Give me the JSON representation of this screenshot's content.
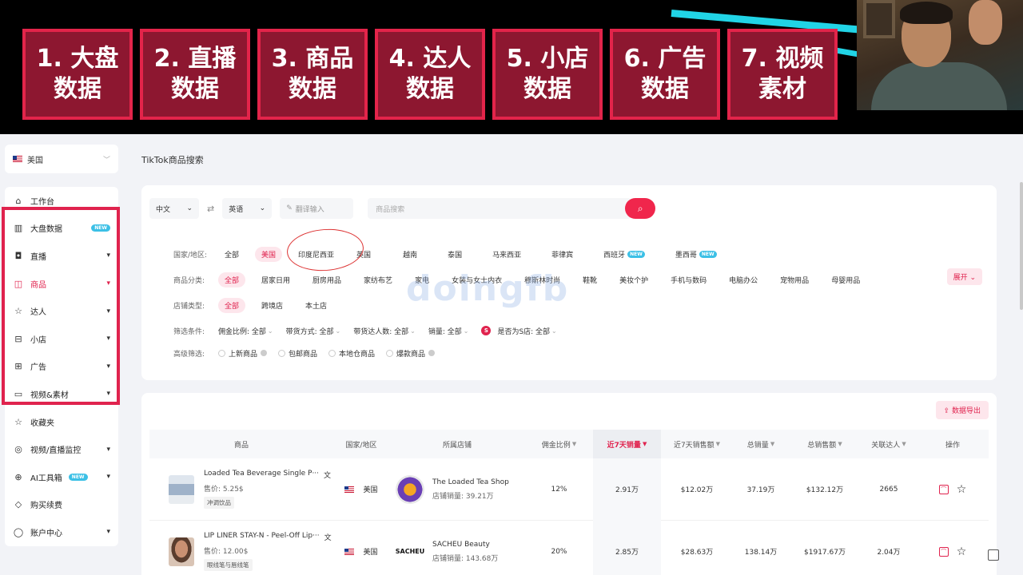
{
  "banner": {
    "tiles": [
      {
        "line1": "1. 大盘",
        "line2": "数据"
      },
      {
        "line1": "2. 直播",
        "line2": "数据"
      },
      {
        "line1": "3. 商品",
        "line2": "数据"
      },
      {
        "line1": "4. 达人",
        "line2": "数据"
      },
      {
        "line1": "5. 小店",
        "line2": "数据"
      },
      {
        "line1": "6. 广告",
        "line2": "数据"
      },
      {
        "line1": "7. 视频",
        "line2": "素材"
      }
    ],
    "tile_color": "#8d1730",
    "tile_border": "#e3244a"
  },
  "sidebar": {
    "region": "美国",
    "items": [
      {
        "label": "工作台",
        "icon": "home-icon"
      },
      {
        "label": "大盘数据",
        "icon": "bar-chart-icon",
        "badge": "NEW"
      },
      {
        "label": "直播",
        "icon": "live-icon",
        "arrow": "▾"
      },
      {
        "label": "商品",
        "icon": "bag-icon",
        "arrow": "▾"
      },
      {
        "label": "达人",
        "icon": "star-person-icon",
        "arrow": "▾"
      },
      {
        "label": "小店",
        "icon": "store-icon",
        "arrow": "▾"
      },
      {
        "label": "广告",
        "icon": "ad-icon",
        "arrow": "▾"
      },
      {
        "label": "视频&素材",
        "icon": "video-icon",
        "arrow": "▾"
      },
      {
        "label": "收藏夹",
        "icon": "star-icon"
      },
      {
        "label": "视频/直播监控",
        "icon": "monitor-icon",
        "arrow": "▾"
      },
      {
        "label": "AI工具箱",
        "icon": "ai-icon",
        "badge": "NEW",
        "arrow": "▾"
      },
      {
        "label": "购买续费",
        "icon": "diamond-icon"
      },
      {
        "label": "账户中心",
        "icon": "user-icon",
        "arrow": "▾"
      }
    ]
  },
  "page_title": "TikTok商品搜索",
  "search": {
    "source_lang": "中文",
    "target_lang": "英语",
    "translate_placeholder": "翻译输入",
    "search_placeholder": "商品搜索"
  },
  "filters": {
    "country_label": "国家/地区:",
    "countries": [
      {
        "label": "全部"
      },
      {
        "label": "美国",
        "selected": true
      },
      {
        "label": "印度尼西亚"
      },
      {
        "label": "英国"
      },
      {
        "label": "越南"
      },
      {
        "label": "泰国"
      },
      {
        "label": "马来西亚"
      },
      {
        "label": "菲律宾"
      },
      {
        "label": "西班牙",
        "badge": "NEW"
      },
      {
        "label": "墨西哥",
        "badge": "NEW"
      }
    ],
    "category_label": "商品分类:",
    "categories": [
      {
        "label": "全部",
        "selected": true
      },
      {
        "label": "居家日用"
      },
      {
        "label": "厨房用品"
      },
      {
        "label": "家纺布艺"
      },
      {
        "label": "家电"
      },
      {
        "label": "女装与女士内衣"
      },
      {
        "label": "穆斯林时尚"
      },
      {
        "label": "鞋靴"
      },
      {
        "label": "美妆个护"
      },
      {
        "label": "手机与数码"
      },
      {
        "label": "电脑办公"
      },
      {
        "label": "宠物用品"
      },
      {
        "label": "母婴用品"
      }
    ],
    "expand": "展开",
    "shop_type_label": "店铺类型:",
    "shop_types": [
      {
        "label": "全部",
        "selected": true
      },
      {
        "label": "跨境店"
      },
      {
        "label": "本土店"
      }
    ],
    "condition_label": "筛选条件:",
    "conditions": [
      "佣金比例: 全部",
      "带货方式: 全部",
      "带货达人数: 全部",
      "销量: 全部",
      "是否为S店: 全部"
    ],
    "advanced_label": "高级筛选:",
    "advanced": [
      "上新商品",
      "包邮商品",
      "本地仓商品",
      "爆款商品"
    ]
  },
  "watermark": "doingfb",
  "table": {
    "export": "数据导出",
    "headers": [
      "商品",
      "国家/地区",
      "所属店铺",
      "佣金比例",
      "近7天销量",
      "近7天销售额",
      "总销量",
      "总销售额",
      "关联达人",
      "操作"
    ],
    "rows": [
      {
        "name": "Loaded Tea Beverage Single P···",
        "price": "售价: 5.25$",
        "tag": "冲调饮品",
        "country": "美国",
        "shop": "The Loaded Tea Shop",
        "shop_sales": "店铺销量: 39.21万",
        "commission": "12%",
        "sales_7d": "2.91万",
        "revenue_7d": "$12.02万",
        "total_sales": "37.19万",
        "total_revenue": "$132.12万",
        "creators": "2665"
      },
      {
        "name": "LIP LINER STAY-N - Peel-Off Lip···",
        "price": "售价: 12.00$",
        "tag": "眼线笔与唇线笔",
        "country": "美国",
        "shop": "SACHEU Beauty",
        "shop_logo": "SACHEU",
        "shop_sales": "店铺销量: 143.68万",
        "commission": "20%",
        "sales_7d": "2.85万",
        "revenue_7d": "$28.63万",
        "total_sales": "138.14万",
        "total_revenue": "$1917.67万",
        "creators": "2.04万"
      }
    ]
  },
  "colors": {
    "accent": "#e0234e",
    "badge": "#3cc0e6"
  }
}
